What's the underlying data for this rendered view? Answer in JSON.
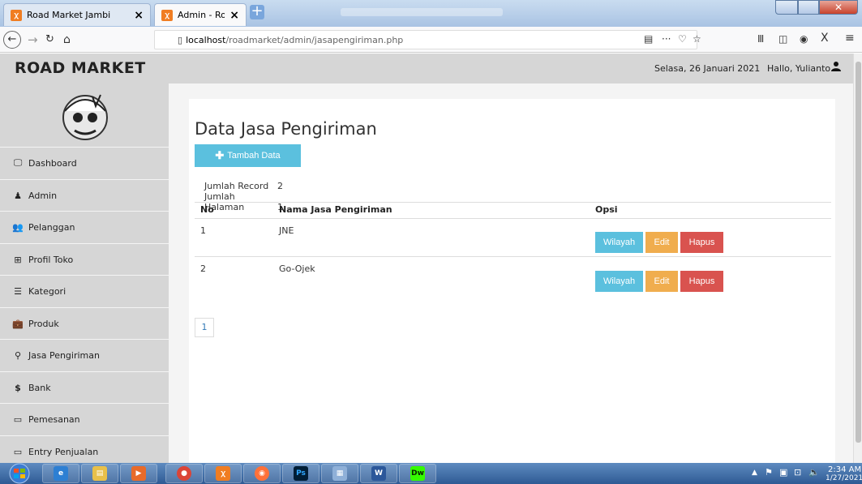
{
  "browser": {
    "tabs": [
      {
        "title": "Road Market Jambi",
        "active": false
      },
      {
        "title": "Admin - Road Market",
        "active": true
      }
    ],
    "url_host": "localhost",
    "url_path": "/roadmarket/admin/jasapengiriman.php"
  },
  "header": {
    "brand": "ROAD MARKET",
    "date": "Selasa, 26 Januari 2021",
    "greeting": "Hallo, Yulianto"
  },
  "sidebar": {
    "items": [
      {
        "label": "Dashboard",
        "icon": "monitor-icon"
      },
      {
        "label": "Admin",
        "icon": "user-icon"
      },
      {
        "label": "Pelanggan",
        "icon": "users-icon"
      },
      {
        "label": "Profil Toko",
        "icon": "table-icon"
      },
      {
        "label": "Kategori",
        "icon": "list-icon"
      },
      {
        "label": "Produk",
        "icon": "briefcase-icon"
      },
      {
        "label": "Jasa Pengiriman",
        "icon": "map-marker-icon"
      },
      {
        "label": "Bank",
        "icon": "dollar-icon"
      },
      {
        "label": "Pemesanan",
        "icon": "credit-card-icon"
      },
      {
        "label": "Entry Penjualan",
        "icon": "credit-card-icon"
      }
    ]
  },
  "main": {
    "title": "Data Jasa Pengiriman",
    "add_button": "Tambah Data",
    "record_label": "Jumlah Record",
    "record_value": "2",
    "pages_label": "Jumlah Halaman",
    "pages_value": "1",
    "table": {
      "headers": [
        "No",
        "Nama Jasa Pengiriman",
        "Opsi"
      ],
      "rows": [
        {
          "no": "1",
          "name": "JNE"
        },
        {
          "no": "2",
          "name": "Go-Ojek"
        }
      ],
      "actions": {
        "wilayah": "Wilayah",
        "edit": "Edit",
        "hapus": "Hapus"
      }
    },
    "pagination": [
      "1"
    ]
  },
  "taskbar": {
    "apps": [
      "Ps",
      "Dw"
    ],
    "time": "2:34 AM",
    "date": "1/27/2021"
  },
  "colors": {
    "info": "#5bc0de",
    "warning": "#f0ad4e",
    "danger": "#d9534f",
    "sidebar": "#d6d6d6"
  }
}
